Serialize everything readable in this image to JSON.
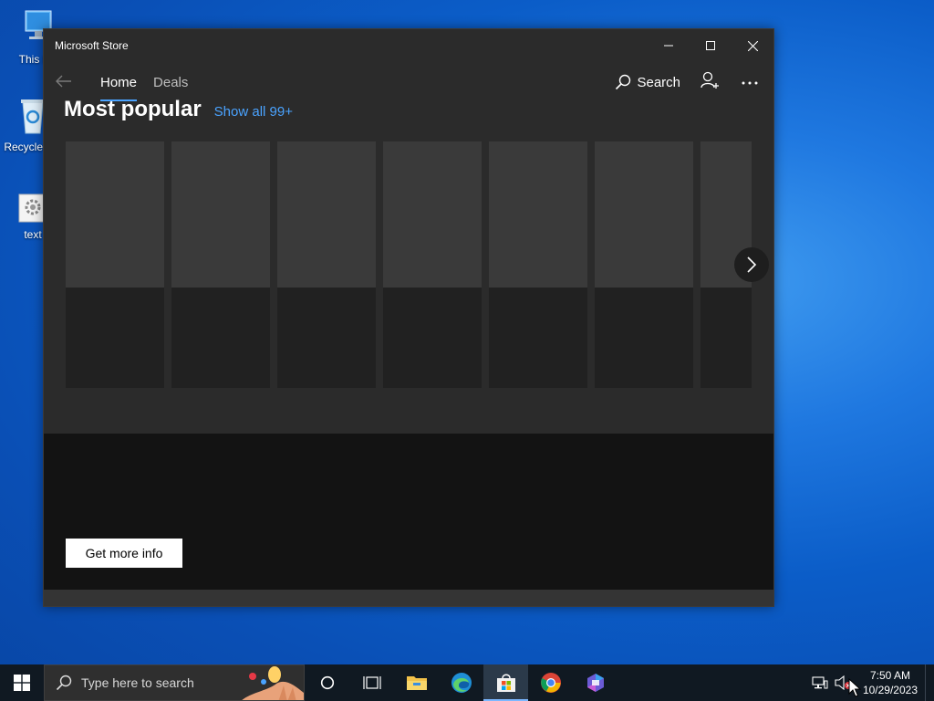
{
  "desktop": {
    "icons": [
      {
        "label": "This PC",
        "icon": "this-pc-icon"
      },
      {
        "label": "Recycle Bin",
        "icon": "recycle-bin-icon"
      },
      {
        "label": "text",
        "icon": "text-file-icon"
      }
    ]
  },
  "window": {
    "title": "Microsoft Store",
    "controls": [
      "minimize",
      "maximize",
      "close"
    ]
  },
  "nav": {
    "tabs": [
      {
        "label": "Home",
        "active": true
      },
      {
        "label": "Deals",
        "active": false
      }
    ],
    "search_label": "Search"
  },
  "section": {
    "title": "Most popular",
    "link": "Show all 99+"
  },
  "promo": {
    "button_label": "Get more info"
  },
  "taskbar": {
    "search_placeholder": "Type here to search",
    "apps": [
      "cortana-icon",
      "task-view-icon",
      "file-explorer-icon",
      "edge-icon",
      "microsoft-store-icon",
      "chrome-icon",
      "copilot-icon"
    ],
    "active_app": "microsoft-store-icon",
    "time": "7:50 AM",
    "date": "10/29/2023"
  },
  "colors": {
    "accent": "#4aa3ff",
    "window_bg": "#2b2b2b",
    "taskbar_bg": "#101922"
  }
}
